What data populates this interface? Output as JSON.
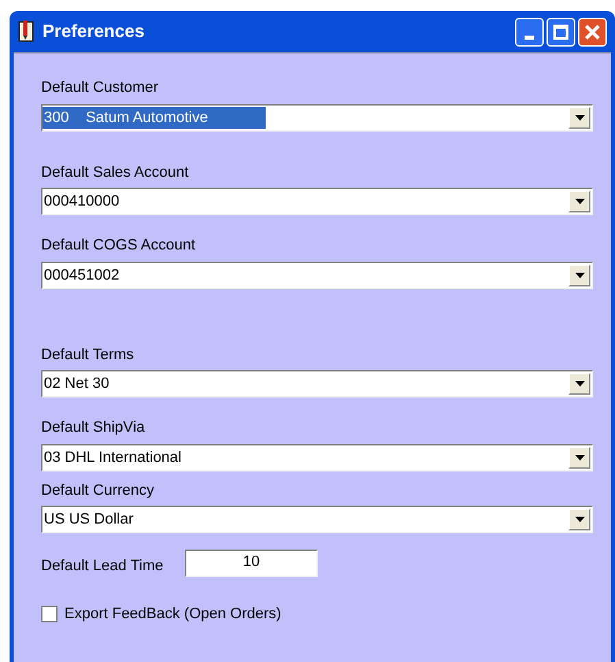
{
  "window": {
    "title": "Preferences"
  },
  "fields": [
    {
      "kind": "combo",
      "label": "Default Customer",
      "value": "300    Satum Automotive",
      "selected": true
    },
    {
      "kind": "combo",
      "label": "Default Sales Account",
      "value": "000410000",
      "selected": false
    },
    {
      "kind": "combo",
      "label": "Default COGS Account",
      "value": "000451002",
      "selected": false
    },
    {
      "kind": "combo",
      "label": "Default Terms",
      "value": "02 Net 30",
      "selected": false
    },
    {
      "kind": "combo",
      "label": "Default ShipVia",
      "value": "03 DHL International",
      "selected": false
    },
    {
      "kind": "combo",
      "label": "Default Currency",
      "value": "US US Dollar",
      "selected": false
    },
    {
      "kind": "text",
      "label": "Default Lead Time",
      "value": "10",
      "selected": false
    },
    {
      "kind": "checkbox",
      "label": "Export FeedBack (Open Orders)",
      "checked": false
    }
  ]
}
